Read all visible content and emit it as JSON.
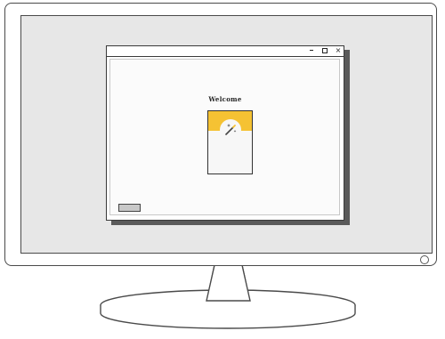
{
  "app_window": {
    "title_bar": {
      "controls": {
        "minimize_icon": "minimize-icon",
        "maximize_icon": "maximize-icon",
        "close_icon": "close-icon",
        "close_glyph": "×"
      }
    },
    "welcome": {
      "title": "Welcome",
      "card_icon": "magic-wand-icon",
      "card_accent_color": "#f5c233"
    }
  },
  "colors": {
    "screen_background": "#e7e7e7",
    "window_background": "#ffffff",
    "footer_button": "#c8c8c8"
  }
}
